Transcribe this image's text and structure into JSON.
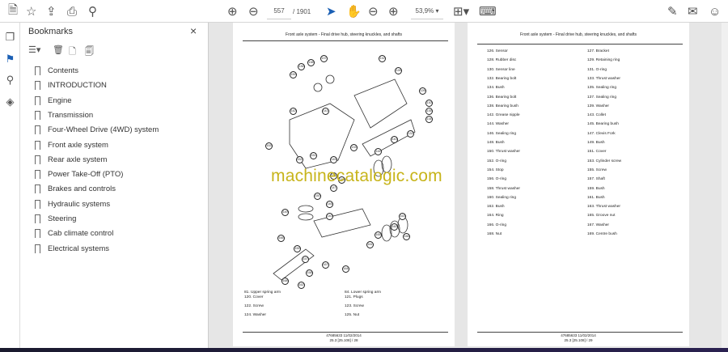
{
  "toolbar": {
    "page_current": "557",
    "page_total": "/ 1901",
    "zoom": "53,9%"
  },
  "bookmarks": {
    "title": "Bookmarks",
    "close": "×",
    "items": [
      "Contents",
      "INTRODUCTION",
      "Engine",
      "Transmission",
      "Four-Wheel Drive (4WD) system",
      "Front axle system",
      "Rear axle system",
      "Power Take-Off (PTO)",
      "Brakes and controls",
      "Hydraulic systems",
      "Steering",
      "Cab climate control",
      "Electrical systems"
    ]
  },
  "left_page": {
    "header": "Front axle system - Final drive hub, steering knuckles, and shafts",
    "callouts": [
      "159",
      "136",
      "138",
      "137",
      "132",
      "128",
      "126",
      "130",
      "135",
      "134",
      "142",
      "141",
      "131",
      "143",
      "144",
      "133",
      "145",
      "153",
      "152",
      "151",
      "154",
      "150",
      "148",
      "147",
      "146",
      "140",
      "149",
      "163",
      "160",
      "156",
      "165",
      "161",
      "155",
      "157",
      "167",
      "164",
      "158",
      "162",
      "168",
      "166"
    ],
    "legend": [
      [
        "81. Upper spring arm",
        "84. Lower spring arm"
      ],
      [
        "120. Cover",
        "121. Plugs"
      ],
      [
        "122. Screw",
        "123. Screw"
      ],
      [
        "124. Washer",
        "125. Nut"
      ]
    ],
    "footer1": "47685633 11/02/2014",
    "footer2": "25.3 [25.108] / 28"
  },
  "right_page": {
    "header": "Front axle system - Final drive hub, steering knuckles, and shafts",
    "rows": [
      [
        "126. Sensor",
        "127. Bracket"
      ],
      [
        "128. Rubber disc",
        "129. Retaining ring"
      ],
      [
        "130. Sensor line",
        "131. O-ring"
      ],
      [
        "132. Bearing bolt",
        "133. Thrust washer"
      ],
      [
        "134. Bush",
        "135. Sealing ring"
      ],
      [
        "136. Bearing bolt",
        "137. Sealing ring"
      ],
      [
        "138. Bearing bush",
        "139. Washer"
      ],
      [
        "142. Grease nipple",
        "143. Collet"
      ],
      [
        "144. Washer",
        "145. Bearing bush"
      ],
      [
        "146. Sealing ring",
        "147. Clevis Fork"
      ],
      [
        "148. Bush",
        "149. Bush"
      ],
      [
        "150. Thrust washer",
        "151. Cover"
      ],
      [
        "152. O-ring",
        "153. Cylinder screw"
      ],
      [
        "154. Stop",
        "155. Screw"
      ],
      [
        "156. O-ring",
        "157. Shaft"
      ],
      [
        "158. Thrust washer",
        "159. Bush"
      ],
      [
        "160. Sealing ring",
        "161. Bush"
      ],
      [
        "162. Bush",
        "163. Thrust washer"
      ],
      [
        "164. Ring",
        "165. Groove nut"
      ],
      [
        "166. O-ring",
        "167. Washer"
      ],
      [
        "168. Nut",
        "169. Centre bush"
      ]
    ],
    "footer1": "47685633 11/02/2014",
    "footer2": "25.3 [25.108] / 29"
  },
  "watermark": "machinecatalogic.com"
}
